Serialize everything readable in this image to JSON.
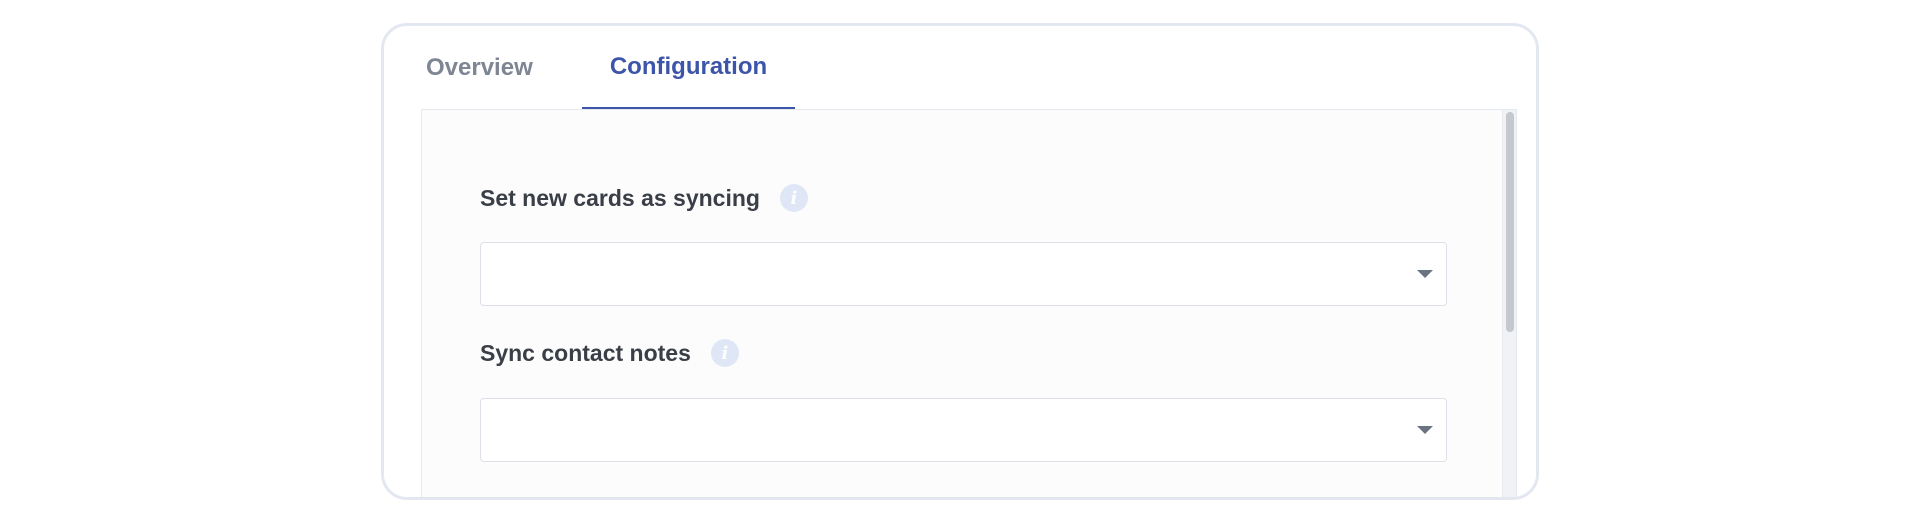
{
  "tabs": [
    {
      "label": "Overview",
      "active": false
    },
    {
      "label": "Configuration",
      "active": true
    }
  ],
  "fields": [
    {
      "label": "Set new cards as syncing",
      "info_icon": "info-icon",
      "value": ""
    },
    {
      "label": "Sync contact notes",
      "info_icon": "info-icon",
      "value": ""
    }
  ],
  "icons": {
    "info_glyph": "i"
  },
  "colors": {
    "active_tab": "#3d55a8",
    "inactive_tab": "#7e8593",
    "info_icon_bg": "#dfe7f6"
  }
}
